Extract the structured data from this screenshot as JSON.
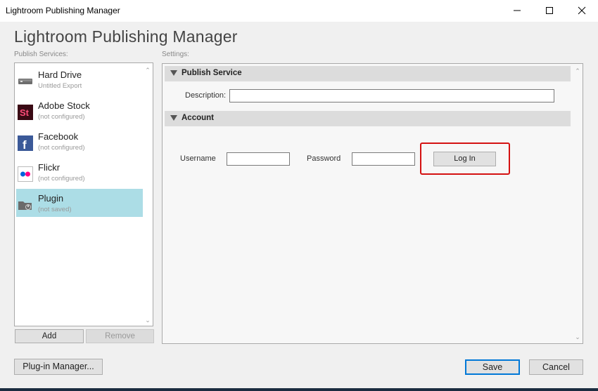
{
  "window": {
    "title": "Lightroom Publishing Manager",
    "controls": [
      "minimize-icon",
      "maximize-icon",
      "close-icon"
    ]
  },
  "dialog": {
    "title": "Lightroom Publishing Manager",
    "publish_services_label": "Publish Services:",
    "settings_label": "Settings:"
  },
  "services": [
    {
      "name": "Hard Drive",
      "status": "Untitled Export",
      "icon": "hard-drive-icon"
    },
    {
      "name": "Adobe Stock",
      "status": "(not configured)",
      "icon": "adobe-stock-icon"
    },
    {
      "name": "Facebook",
      "status": "(not configured)",
      "icon": "facebook-icon"
    },
    {
      "name": "Flickr",
      "status": "(not configured)",
      "icon": "flickr-icon"
    },
    {
      "name": "Plugin",
      "status": "(not saved)",
      "icon": "plugin-folder-icon",
      "selected": true
    }
  ],
  "service_buttons": {
    "add": "Add",
    "remove": "Remove"
  },
  "settings": {
    "publish_service": {
      "header": "Publish Service",
      "description_label": "Description:",
      "description_value": ""
    },
    "account": {
      "header": "Account",
      "username_label": "Username",
      "username_value": "",
      "password_label": "Password",
      "password_value": "",
      "login_button": "Log In"
    }
  },
  "footer": {
    "plugin_manager": "Plug-in Manager...",
    "save": "Save",
    "cancel": "Cancel"
  },
  "colors": {
    "selected_row": "#acdde6",
    "highlight": "#d41111",
    "primary_border": "#0078d7",
    "adobe_stock": "#3a0a14",
    "facebook": "#3b5998",
    "flickr_blue": "#0063dc",
    "flickr_pink": "#ff0084"
  }
}
